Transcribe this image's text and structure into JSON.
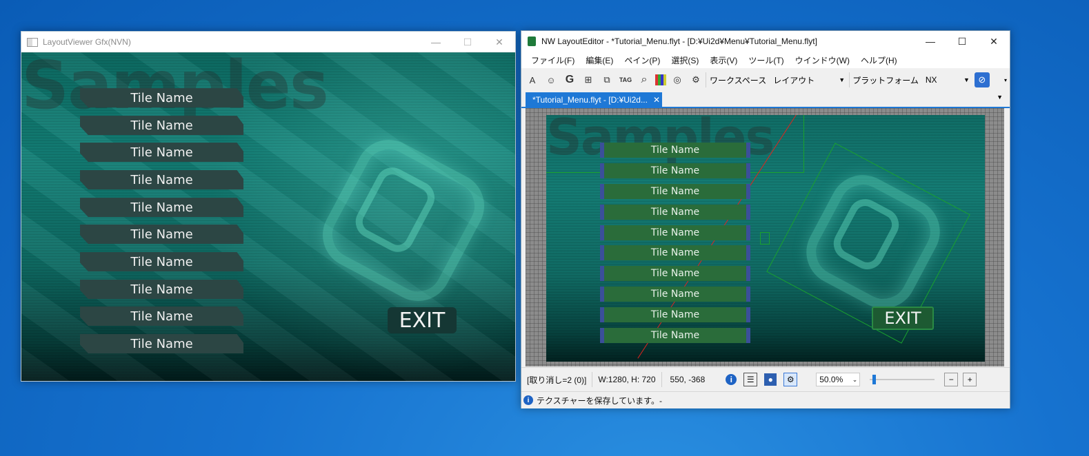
{
  "viewer": {
    "title": "LayoutViewer Gfx(NVN)",
    "watermark": "Samples",
    "tiles": [
      "Tile Name",
      "Tile Name",
      "Tile Name",
      "Tile Name",
      "Tile Name",
      "Tile Name",
      "Tile Name",
      "Tile Name",
      "Tile Name",
      "Tile Name"
    ],
    "exit_label": "EXIT"
  },
  "editor": {
    "title": "NW LayoutEditor - *Tutorial_Menu.flyt - [D:¥Ui2d¥Menu¥Tutorial_Menu.flyt]",
    "menu": [
      "ファイル(F)",
      "編集(E)",
      "ペイン(P)",
      "選択(S)",
      "表示(V)",
      "ツール(T)",
      "ウインドウ(W)",
      "ヘルプ(H)"
    ],
    "toolbar": {
      "workspace_label": "ワークスペース",
      "workspace_value": "レイアウト",
      "platform_label": "プラットフォーム",
      "platform_value": "NX",
      "tag_icon_text": "TAG"
    },
    "doc_tab": "*Tutorial_Menu.flyt - [D:¥Ui2d...",
    "canvas": {
      "watermark": "Samples",
      "tiles": [
        "Tile Name",
        "Tile Name",
        "Tile Name",
        "Tile Name",
        "Tile Name",
        "Tile Name",
        "Tile Name",
        "Tile Name",
        "Tile Name",
        "Tile Name"
      ],
      "exit_label": "EXIT"
    },
    "status": {
      "undo": "[取り消し=2 (0)]",
      "size": "W:1280, H: 720",
      "coords": "550,  -368",
      "zoom": "50.0%",
      "zoom_fraction": 0.05
    },
    "info_message": "テクスチャーを保存しています。-"
  },
  "colors": {
    "desktop": "#1672cf",
    "accent": "#1e78d6",
    "tile_dark": "#2c4644",
    "tile_green": "#2a6c3a"
  }
}
